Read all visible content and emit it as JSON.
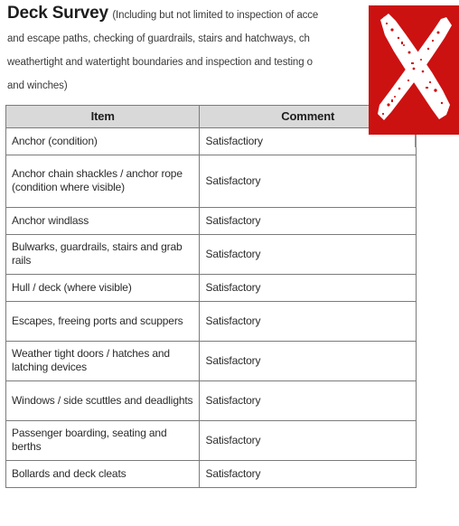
{
  "document": {
    "title": "Deck Survey",
    "subtitle_lines": [
      "(Including but not limited to inspection of acce",
      "and escape paths, checking of guardrails, stairs and hatchways, ch",
      "weathertight and watertight boundaries and inspection and testing o",
      "and winches)"
    ]
  },
  "table": {
    "columns": [
      "Item",
      "Comment"
    ],
    "rows": [
      {
        "item": "Anchor (condition)",
        "comment": "Satisfactiory"
      },
      {
        "item": "Anchor chain shackles / anchor rope (condition where visible)",
        "comment": "Satisfactory"
      },
      {
        "item": "Anchor windlass",
        "comment": "Satisfactory"
      },
      {
        "item": "Bulwarks, guardrails, stairs and grab rails",
        "comment": "Satisfactory"
      },
      {
        "item": "Hull / deck (where visible)",
        "comment": "Satisfactory"
      },
      {
        "item": "Escapes, freeing ports and scuppers",
        "comment": "Satisfactory"
      },
      {
        "item": "Weather tight doors / hatches and latching devices",
        "comment": "Satisfactory"
      },
      {
        "item": "Windows / side scuttles and deadlights",
        "comment": "Satisfactory"
      },
      {
        "item": "Passenger boarding, seating and berths",
        "comment": "Satisfactory"
      },
      {
        "item": "Bollards and deck cleats",
        "comment": "Satisfactory"
      }
    ]
  },
  "overlay": {
    "stamp": "red-x-stamp",
    "background_color": "#CC1111",
    "mark_color": "#FFFFFF"
  },
  "colors": {
    "header_fill": "#D9D9D9",
    "border": "#7B7B7B",
    "text": "#2B2B2B",
    "page_background": "#FFFFFF"
  }
}
